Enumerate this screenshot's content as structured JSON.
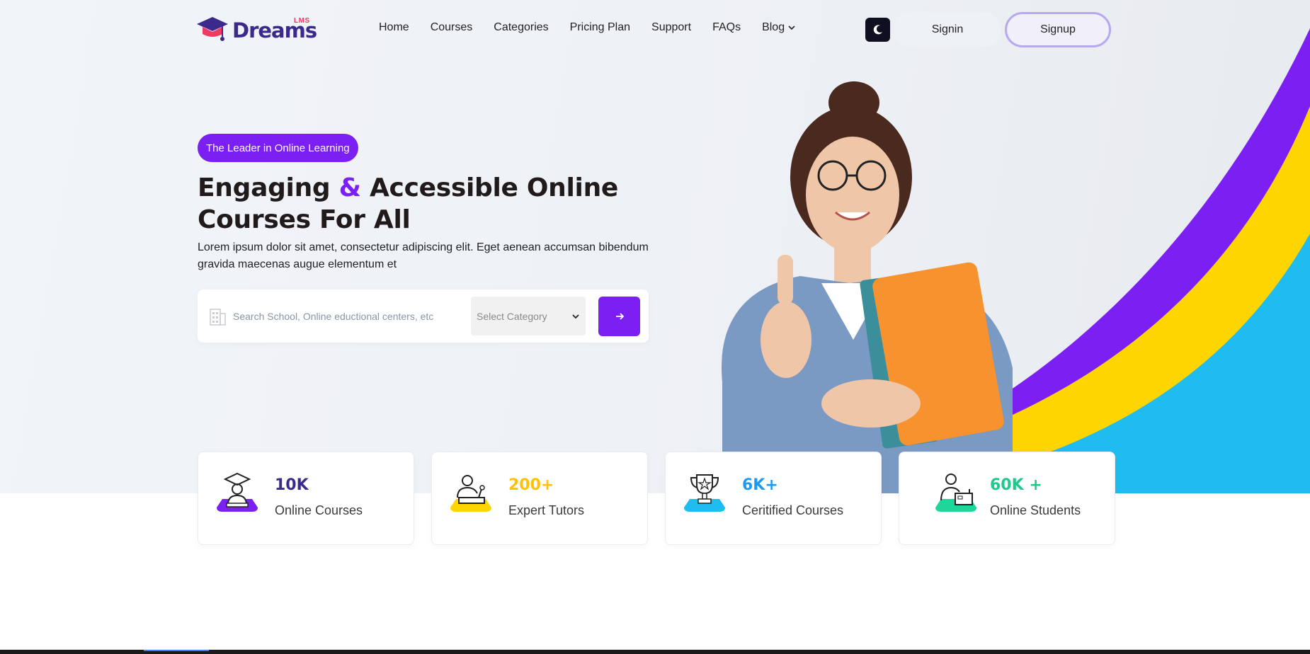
{
  "brand": {
    "name": "Dreams",
    "tag": "LMS"
  },
  "nav": {
    "items": [
      {
        "label": "Home",
        "icon": ""
      },
      {
        "label": "Courses",
        "icon": ""
      },
      {
        "label": "Categories",
        "icon": ""
      },
      {
        "label": "Pricing Plan",
        "icon": ""
      },
      {
        "label": "Support",
        "icon": ""
      },
      {
        "label": "FAQs",
        "icon": ""
      },
      {
        "label": "Blog",
        "icon": "chevron-down-icon"
      }
    ],
    "theme_toggle_icon": "moon-icon",
    "signin": "Signin",
    "signup": "Signup"
  },
  "hero": {
    "badge": "The Leader in Online Learning",
    "headline_part1": "Engaging ",
    "headline_amp": "&",
    "headline_part2": " Accessible Online Courses For All",
    "subtext": "Lorem ipsum dolor sit amet, consectetur adipiscing elit. Eget aenean accumsan bibendum gravida maecenas augue elementum et",
    "search": {
      "placeholder": "Search School, Online eductional centers, etc",
      "category_selected": "Select Category",
      "submit_icon": "arrow-right-icon"
    }
  },
  "stats": [
    {
      "value": "10K",
      "label": "Online Courses",
      "color": "#3b2a8c",
      "accent": "#7c1ff2",
      "icon": "graduate-icon"
    },
    {
      "value": "200+",
      "label": "Expert Tutors",
      "color": "#ffc107",
      "accent": "#ffd500",
      "icon": "tutor-icon"
    },
    {
      "value": "6K+",
      "label": "Ceritified Courses",
      "color": "#1e9bf0",
      "accent": "#1ebcef",
      "icon": "trophy-icon"
    },
    {
      "value": "60K +",
      "label": "Online Students",
      "color": "#1fc98c",
      "accent": "#1fd59a",
      "icon": "student-icon"
    }
  ],
  "colors": {
    "primary": "#7c1ff2",
    "yellow": "#ffd500",
    "cyan": "#1ebcef"
  }
}
